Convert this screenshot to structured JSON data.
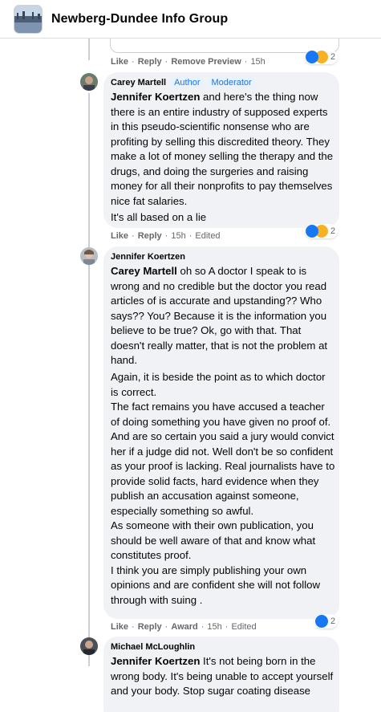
{
  "group": {
    "title": "Newberg-Dundee Info Group"
  },
  "actions": {
    "like": "Like",
    "reply": "Reply",
    "award": "Award",
    "remove_preview": "Remove Preview",
    "edited": "Edited",
    "sep": "·"
  },
  "comments": [
    {
      "meta": {
        "time": "15h",
        "reactions": "2"
      }
    },
    {
      "author": "Carey Martell",
      "badges": [
        "Author",
        "Moderator"
      ],
      "mention": "Jennifer Koertzen",
      "text1": " and here's the thing now there is an entire industry of supposed experts in this pseudo-scientific nonsense who are profiting by selling this discredited theory. They make a lot of money selling the therapy and the drugs, and doing the surgeries and raising money for all their nonprofits to pay themselves nice fat salaries.",
      "text2": "It's all based on a lie",
      "time": "15h",
      "reactions": "2"
    },
    {
      "author": "Jennifer Koertzen",
      "mention": "Carey Martell",
      "text1": " oh so A doctor I speak to is wrong and no credible but the doctor you read articles of is accurate and upstanding?? Who says?? You? Because it is the information you believe to be true? Ok, go with that. That doesn't really matter, that is not the problem at hand.",
      "text2": "Again, it is beside the point as to which doctor is correct.\nThe fact remains you have accused a teacher of doing something you have given no proof of. And are so certain you said a jury would convict her if a judge did not. Well don't be so confident as your proof is lacking. Real journalists have to provide solid facts, hard evidence when they publish an accusation against someone, especially something so awful.\nAs someone with their own publication, you should be well aware of that and know what constitutes proof.\nI think you are simply publishing your own opinions and are confident she will not follow through with suing .",
      "time": "15h",
      "reactions": "2"
    },
    {
      "author": "Michael McLoughlin",
      "mention": "Jennifer Koertzen",
      "text1": " It's not being born in the wrong body. It's being unable to accept yourself and your body. Stop sugar coating disease"
    }
  ],
  "colors": {
    "accent": "#1877f2",
    "sad": "#f7b125",
    "bubble": "#f0f2f5",
    "badge_text": "#1b74e4"
  }
}
